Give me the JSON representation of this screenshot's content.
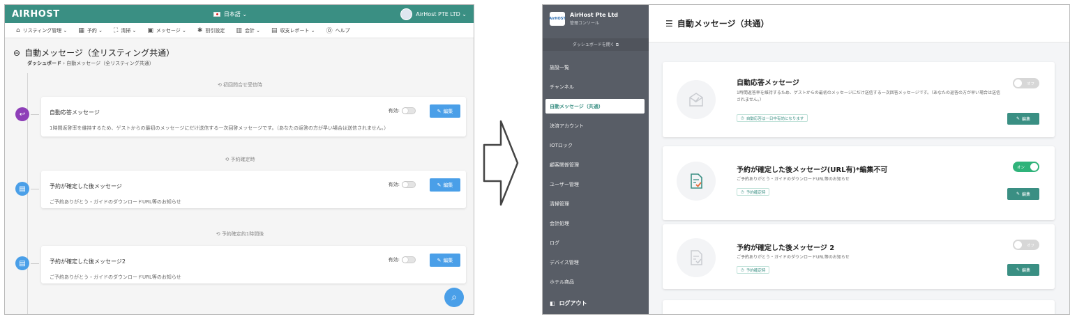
{
  "old_ui": {
    "logo": "AIRHOST",
    "language": "日本語 ⌄",
    "account": "AirHost PTE LTD ⌄",
    "menu": [
      {
        "label": "リスティング管理 ⌄",
        "icon": "home-icon"
      },
      {
        "label": "予約 ⌄",
        "icon": "calendar-icon"
      },
      {
        "label": "清掃 ⌄",
        "icon": "broom-icon"
      },
      {
        "label": "メッセージ ⌄",
        "icon": "message-icon"
      },
      {
        "label": "割引設定",
        "icon": "gear-icon"
      },
      {
        "label": "会計 ⌄",
        "icon": "ledger-icon"
      },
      {
        "label": "収支レポート ⌄",
        "icon": "report-icon"
      },
      {
        "label": "ヘルプ",
        "icon": "help-icon"
      }
    ],
    "page_title": "自動メッセージ（全リスティング共通）",
    "breadcrumb_home": "ダッシュボード",
    "breadcrumb_sep": "›",
    "breadcrumb_current": "自動メッセージ（全リスティング共通）",
    "triggers": [
      "初回問合せ受信時",
      "予約確定時",
      "予約確定約1時間後"
    ],
    "enabled_label": "有効:",
    "edit_label": "編集",
    "cards": [
      {
        "title": "自動応答メッセージ",
        "desc": "1時間返答率を維持するため、ゲストからの最初のメッセージにだけ送信する一次回答メッセージです。（あなたの返答の方が早い場合は送信されません。）",
        "dot_color": "#8e3fb8"
      },
      {
        "title": "予約が確定した後メッセージ",
        "desc": "ご予約ありがとう・ガイドのダウンロードURL等のお知らせ",
        "dot_color": "#4a9fe8"
      },
      {
        "title": "予約が確定した後メッセージ2",
        "desc": "ご予約ありがとう・ガイドのダウンロードURL等のお知らせ",
        "dot_color": "#4a9fe8"
      }
    ]
  },
  "new_ui": {
    "brand_logo": "AirHOST",
    "brand_name": "AirHost Pte Ltd",
    "brand_sub": "管理コンソール",
    "dashboard_button": "ダッシュボードを開く ⧉",
    "nav": [
      "施設一覧",
      "チャンネル",
      "自動メッセージ（共通）",
      "決済アカウント",
      "IOTロック",
      "顧客関係管理",
      "ユーザー管理",
      "清掃管理",
      "会計処理",
      "ログ",
      "デバイス管理",
      "ホテル商品"
    ],
    "logout": "ログアウト",
    "header_title": "自動メッセージ（共通）",
    "toggle_on": "オン",
    "toggle_off": "オフ",
    "edit_label": "編集",
    "cards": [
      {
        "title": "自動応答メッセージ",
        "desc": "1時間返答率を維持するため、ゲストからの最初のメッセージにだけ送信する一次回答メッセージです。（あなたの返答の方が早い場合は送信されません。）",
        "tag": "自動応答は一日中有効になります",
        "enabled": false
      },
      {
        "title": "予約が確定した後メッセージ(URL有)*編集不可",
        "desc": "ご予約ありがとう・ガイドのダウンロードURL等のお知らせ",
        "tag": "予約確定時",
        "enabled": true
      },
      {
        "title": "予約が確定した後メッセージ 2",
        "desc": "ご予約ありがとう・ガイドのダウンロードURL等のお知らせ",
        "tag": "予約確定時",
        "enabled": false
      }
    ]
  }
}
